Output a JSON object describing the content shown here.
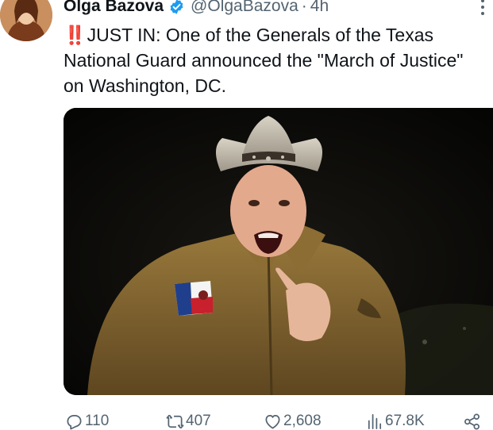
{
  "tweet": {
    "display_name": "Olga Bazova",
    "handle": "@OlgaBazova",
    "separator": "·",
    "time": "4h",
    "emoji": "‼️",
    "text": "JUST IN: One of the Generals of the Texas National Guard announced the \"March of Justice\" on Washington, DC."
  },
  "actions": {
    "replies": "110",
    "reposts": "407",
    "likes": "2,608",
    "views": "67.8K"
  },
  "icons": {
    "verified": "verified-badge-icon",
    "more": "more-options-icon",
    "reply": "reply-icon",
    "repost": "repost-icon",
    "like": "heart-icon",
    "views": "views-chart-icon",
    "share": "share-icon"
  },
  "colors": {
    "verified_blue": "#1d9bf0",
    "secondary_text": "#536471",
    "emoji_red": "#d4202c"
  }
}
